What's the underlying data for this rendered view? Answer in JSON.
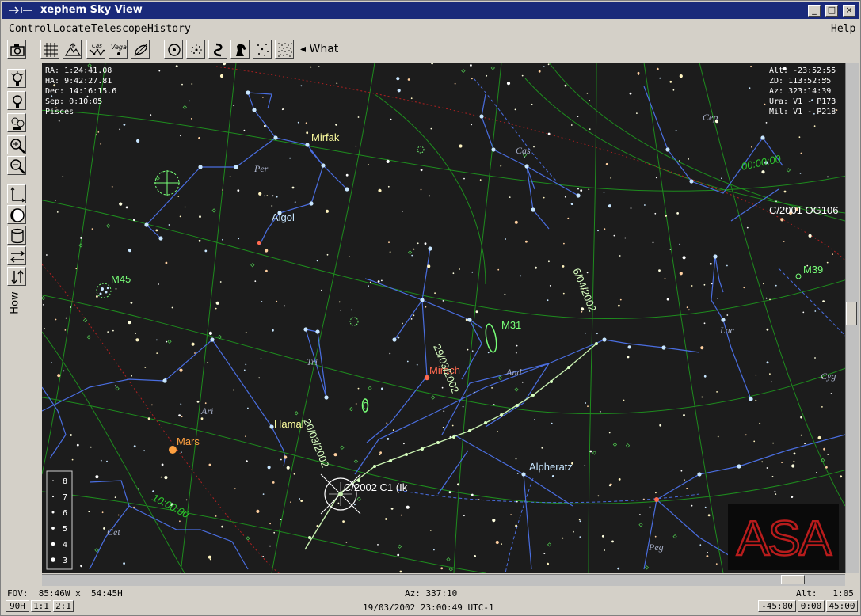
{
  "window": {
    "title": "xephem Sky View",
    "controls": [
      "_",
      "□",
      "×"
    ]
  },
  "menu": {
    "items": [
      "Control",
      "Locate",
      "Telescope",
      "History"
    ],
    "help": "Help"
  },
  "toolbar": {
    "what_label": "What",
    "cas_icon_text": "Cas",
    "vega_icon_text": "Vega"
  },
  "left_tools": {
    "how_label": "How"
  },
  "info_left": [
    "RA:     1:24:41.08",
    "HA:     9:42:27.81",
    "Dec:   14:16:15.6",
    "Sep:    0:10:05",
    "Pisces"
  ],
  "info_right": [
    "Alt:   -23:52:55",
    "ZD:    113:52:55",
    "Az:    323:14:39",
    "Ura: V1 - P173",
    "Mil: V1 - P218"
  ],
  "labels": {
    "mirfak": "Mirfak",
    "algol": "Algol",
    "m45": "M45",
    "m31": "M31",
    "mirach": "Mirach",
    "hamal": "Hamal",
    "mars": "Mars",
    "alpheratz": "Alpheratz",
    "m39": "M39",
    "comet_og": "C/2001 OG106",
    "comet_c1": "C/2002 C1 (Ik",
    "ra_10h": "10:00:00",
    "ra_00h": "00:00:00",
    "date_2003": "20/03/2002",
    "date_2903": "29/03/2002",
    "date_0604": "6/04/2002",
    "zero": "0"
  },
  "constellations": {
    "per": "Per",
    "cas": "Cas",
    "cep": "Cep",
    "tri": "Tri",
    "and": "And",
    "ari": "Ari",
    "lac": "Lac",
    "cyg": "Cyg",
    "cet": "Cet",
    "peg": "Peg"
  },
  "magnitude_legend": [
    "8",
    "7",
    "6",
    "5",
    "4",
    "3"
  ],
  "logo_text": "ASA",
  "colors": {
    "sky": "#1c1c1c",
    "grid": "#1e8c1e",
    "constellation": "#4a6ee0",
    "label_yellow": "#ffffa0",
    "label_green": "#78ff78",
    "mars": "#ffa040",
    "mirach": "#ff6a50",
    "titlebar": "#1a2a7a"
  },
  "status": {
    "fov": "FOV:  85:46W x  54:45H",
    "az": "Az: 337:10",
    "alt": "Alt:   1:05",
    "datetime": "19/03/2002 23:00:49 UTC-1",
    "buttons_left": [
      "90H",
      "1:1",
      "2:1"
    ],
    "buttons_right": [
      "-45:00",
      "0:00",
      "45:00"
    ]
  }
}
